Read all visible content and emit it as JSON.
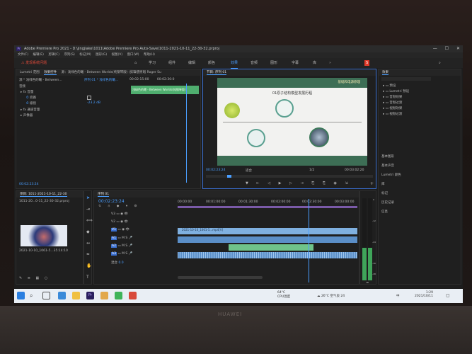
{
  "titlebar": {
    "text": "Adobe Premiere Pro 2021 - D:\\jingjiake\\1011\\Adobe Premiere Pro Auto-Save\\1011-2021-10-11_22-30-32.prproj",
    "app_logo": "Pr"
  },
  "menu": [
    "文件(F)",
    "编辑(E)",
    "剪辑(C)",
    "序列(S)",
    "标记(M)",
    "图形(G)",
    "视图(V)",
    "窗口(W)",
    "帮助(H)"
  ],
  "workbar": {
    "warning": "发现系统问题",
    "workspaces": [
      "学习",
      "组件",
      "编辑",
      "颜色",
      "效果",
      "音频",
      "图形",
      "字幕",
      "库"
    ],
    "active_workspace": "效果"
  },
  "effect_controls": {
    "tabs": [
      "Lumetri 范围",
      "效果控件",
      "源：浅绿色的曦 - Between Worlds(纯钢琴版) (剪辑使原唱 Roger Su"
    ],
    "source": "源 * 浅绿色的曦 - Between...",
    "sequence": "序列 01 * 浅绿色的曦...",
    "section": "音频",
    "fx": "音量",
    "bypass": "旁路",
    "level_label": "级别",
    "level_value": "-23.2 dB",
    "channel_volume": "通道音量",
    "panner": "声像器",
    "clip_label": "浅绿色的曦 - Between Worlds(纯钢琴版)",
    "timecode": "00:02:23:24",
    "ruler": [
      "00:02:15:00",
      "00:02:30:0"
    ]
  },
  "program_monitor": {
    "tab": "节目: 序列 01",
    "slide_title": "01原子结构模型发展历程",
    "slide_tag": "基础和电源原理",
    "timecode": "00:02:23:24",
    "fit": "适合",
    "quality": "1/2",
    "duration": "00:03:02:20"
  },
  "effects_panel": {
    "title": "效果",
    "items": [
      "预设",
      "Lumetri 预设",
      "音频效果",
      "音频过渡",
      "视频效果",
      "视频过渡"
    ],
    "sections": [
      "基本图形",
      "基本声音",
      "Lumetri 颜色",
      "库",
      "标记",
      "历史记录",
      "信息"
    ]
  },
  "project": {
    "tab": "项目: 1011-2021-10-11_22-30",
    "file": "1011-20...0-11_22-30-32.prproj",
    "clip_name": "2021-10-10_1061-5...35:14:10",
    "clip_duration": "35:14:10"
  },
  "timeline": {
    "tab": "序列 01",
    "timecode": "00:02:23:24",
    "ruler": [
      "00:00:00",
      "00:01:00:00",
      "00:01:30:00",
      "00:02:00:00",
      "00:02:30:00",
      "00:03:00:00"
    ],
    "tracks": [
      "V3",
      "V2",
      "V1",
      "A1",
      "A2",
      "A3"
    ],
    "mix_label": "混合",
    "mix_value": "0.0",
    "v1_clip": "2021-10-10_1061-5...mp4[V]",
    "meter_scale": [
      "0",
      "-12",
      "-24",
      "-36",
      "-48",
      "dB"
    ]
  },
  "taskbar": {
    "weather_temp": "26°C",
    "weather_text": "空气良 24",
    "cpu_temp": "64°C",
    "cpu_label": "CPU温度",
    "time": "1:29",
    "date": "2021/10/11",
    "lang": "中"
  },
  "laptop_brand": "HUAWEI"
}
